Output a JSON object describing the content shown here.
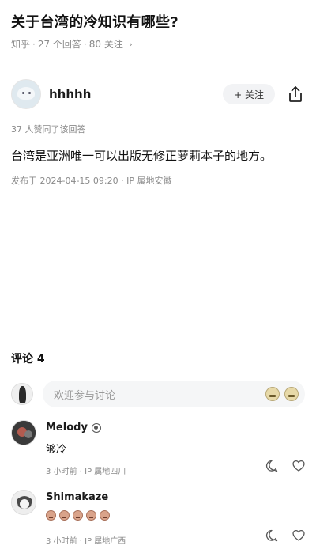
{
  "question": {
    "title": "关于台湾的冷知识有哪些?",
    "meta_source": "知乎",
    "meta_answers": "27 个回答",
    "meta_followers": "80 关注",
    "meta_sep": "·",
    "chevron": "›"
  },
  "answer": {
    "author_name": "hhhhh",
    "follow_label": "+ 关注",
    "upvote_text": "37 人赞同了该回答",
    "body": "台湾是亚洲唯一可以出版无修正萝莉本子的地方。",
    "publish_info": "发布于 2024-04-15 09:20 · IP 属地安徽"
  },
  "comments_section": {
    "title": "评论 4",
    "input_placeholder": "欢迎参与讨论"
  },
  "comments": [
    {
      "name": "Melody",
      "text": "够冷",
      "meta": "3 小时前 · IP 属地四川"
    },
    {
      "name": "Shimakaze",
      "meta": "3 小时前 · IP 属地广西"
    }
  ],
  "icons": {
    "share": "share-icon",
    "comment": "comment-icon",
    "like": "heart-icon",
    "emoji": "emoji-icon",
    "badge": "badge-icon"
  }
}
